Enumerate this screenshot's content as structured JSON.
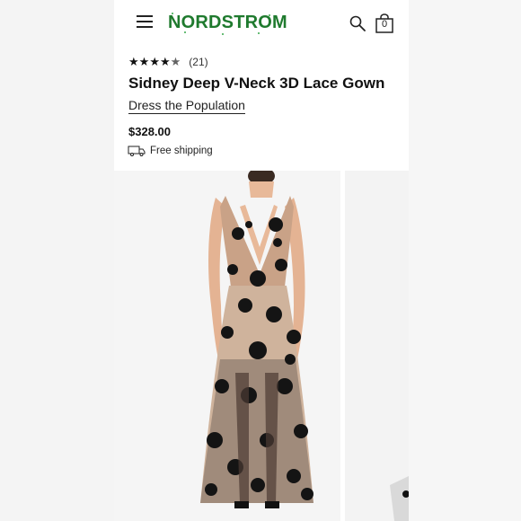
{
  "header": {
    "menu_icon": "hamburger-menu-icon",
    "logo": "NORDSTROM",
    "search_icon": "search-icon",
    "bag_icon": "shopping-bag-icon",
    "bag_count": "0",
    "brand_color": "#1f7a2e"
  },
  "product": {
    "rating_value": 4.5,
    "rating_max": 5,
    "rating_count": "(21)",
    "title": "Sidney Deep V-Neck 3D Lace Gown",
    "brand": "Dress the Population",
    "price": "$328.00",
    "shipping": "Free shipping",
    "shipping_icon": "delivery-truck-icon"
  },
  "gallery": {
    "images": [
      "black-floral-lace-gown-photo",
      "next-photo-peek"
    ]
  }
}
